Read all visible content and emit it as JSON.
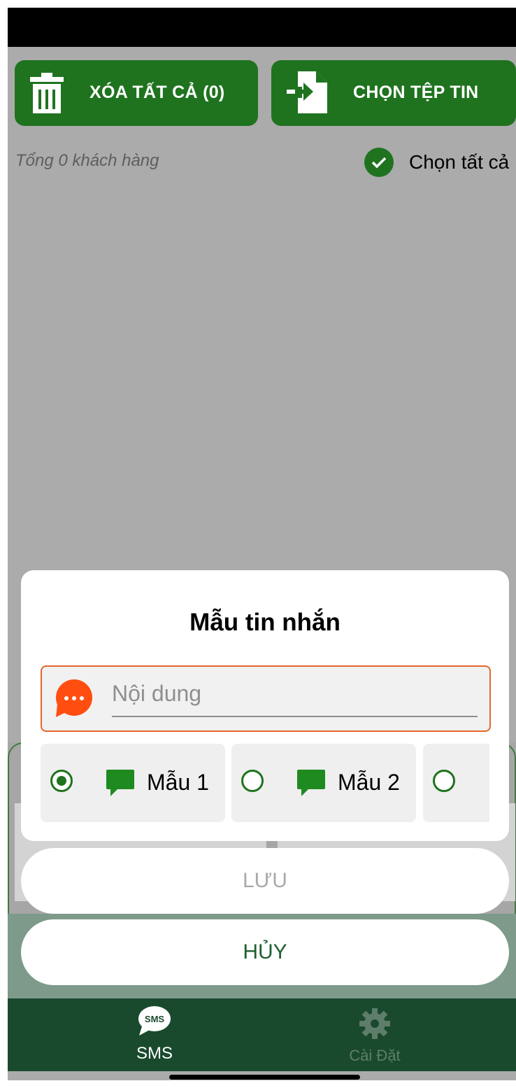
{
  "header": {
    "clear_all_label": "XÓA TẤT CẢ (0)",
    "choose_file_label": "CHỌN TỆP TIN"
  },
  "summary": {
    "total_customers": "Tổng 0 khách hàng",
    "select_all_label": "Chọn tất cả"
  },
  "dialog": {
    "title": "Mẫu tin nhắn",
    "content_placeholder": "Nội dung",
    "templates": [
      {
        "label": "Mẫu 1",
        "selected": true
      },
      {
        "label": "Mẫu 2",
        "selected": false
      },
      {
        "label": "",
        "selected": false
      }
    ],
    "save_label": "LƯU",
    "cancel_label": "HỦY"
  },
  "bottom_nav": {
    "sms_icon_text": "SMS",
    "sms_label": "SMS",
    "settings_label": "Cài Đặt",
    "active": "sms"
  },
  "colors": {
    "primary_green": "#1f731f",
    "nav_background": "#1a4a2e",
    "accent_orange": "#ff4e0f",
    "input_border": "#e4672b",
    "overlay_gray": "#ababab"
  },
  "icons": {
    "clear_all": "trash-icon",
    "choose_file": "file-import-icon",
    "select_all": "check-circle-icon",
    "content": "chat-bubble-dots-icon",
    "template": "message-icon",
    "nav_sms": "sms-bubble-icon",
    "nav_settings": "gear-icon"
  }
}
